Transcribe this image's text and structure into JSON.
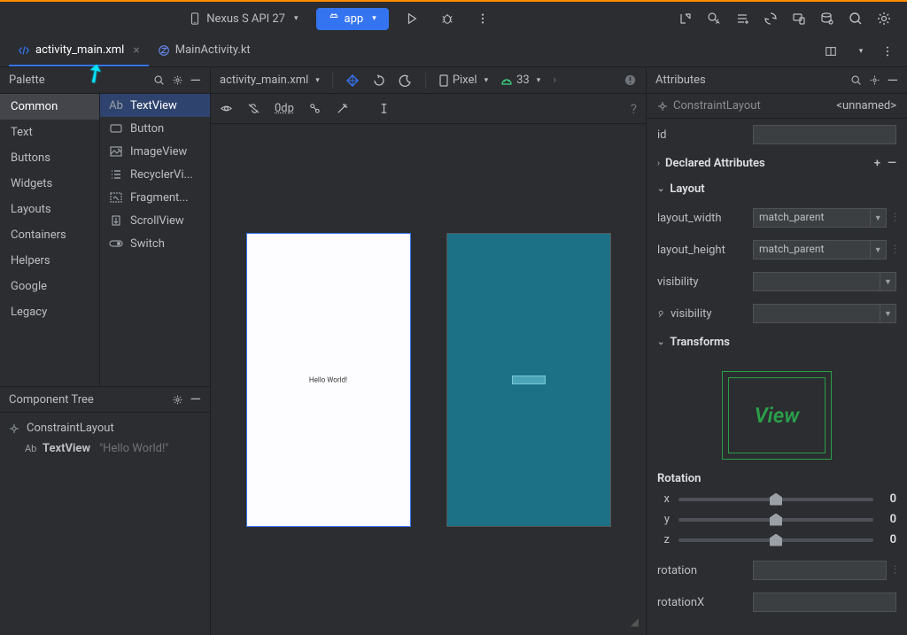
{
  "topbar": {
    "device": "Nexus S API 27",
    "run_config": "app"
  },
  "tabs": {
    "active": "activity_main.xml",
    "inactive": "MainActivity.kt"
  },
  "palette": {
    "title": "Palette",
    "categories": [
      "Common",
      "Text",
      "Buttons",
      "Widgets",
      "Layouts",
      "Containers",
      "Helpers",
      "Google",
      "Legacy"
    ],
    "selected_cat": "Common",
    "items": [
      "TextView",
      "Button",
      "ImageView",
      "RecyclerVi...",
      "Fragment...",
      "ScrollView",
      "Switch"
    ],
    "selected_item": "TextView"
  },
  "tree": {
    "title": "Component Tree",
    "root": "ConstraintLayout",
    "child": "TextView",
    "child_text": "\"Hello World!\""
  },
  "design_toolbar": {
    "breadcrumb": "activity_main.xml",
    "device": "Pixel",
    "api": "33",
    "default_margin": "0dp"
  },
  "preview_text": "Hello World!",
  "attributes": {
    "title": "Attributes",
    "type": "ConstraintLayout",
    "unnamed": "<unnamed>",
    "id_label": "id",
    "declared": "Declared Attributes",
    "layout": "Layout",
    "layout_width_label": "layout_width",
    "layout_width_val": "match_parent",
    "layout_height_label": "layout_height",
    "layout_height_val": "match_parent",
    "visibility_label": "visibility",
    "tools_visibility_label": "visibility",
    "transforms": "Transforms",
    "view_placeholder": "View",
    "rotation_title": "Rotation",
    "axis_x": "x",
    "axis_y": "y",
    "axis_z": "z",
    "axis_val": "0",
    "rotation_label": "rotation",
    "rotationx_label": "rotationX"
  }
}
